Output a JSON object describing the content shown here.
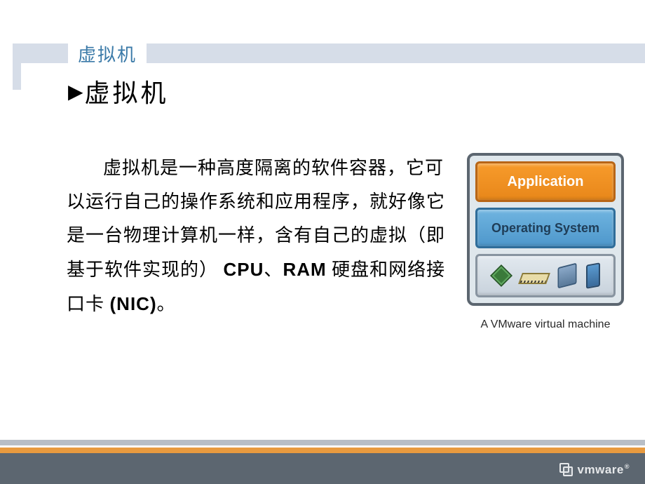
{
  "header": {
    "tab_label": "虚拟机"
  },
  "title": {
    "arrow": "▶",
    "text": "虚拟机"
  },
  "body": {
    "prefix": "虚拟机是一种高度隔离的软件容器，它可以运行自己的操作系统和应用程序，就好像它是一台物理计算机一样，含有自己的虚拟（即基于软件实现的）",
    "bold1": "CPU",
    "sep1": "、",
    "bold2": "RAM",
    "mid": " 硬盘和网络接口卡 ",
    "bold3": "(NIC)",
    "suffix": "。"
  },
  "diagram": {
    "layers": {
      "application": "Application",
      "os": "Operating System"
    },
    "hw_icons": [
      "cpu",
      "ram",
      "disk",
      "nic"
    ],
    "caption": "A VMware virtual machine"
  },
  "footer": {
    "brand": "vmware",
    "mark": "®"
  }
}
